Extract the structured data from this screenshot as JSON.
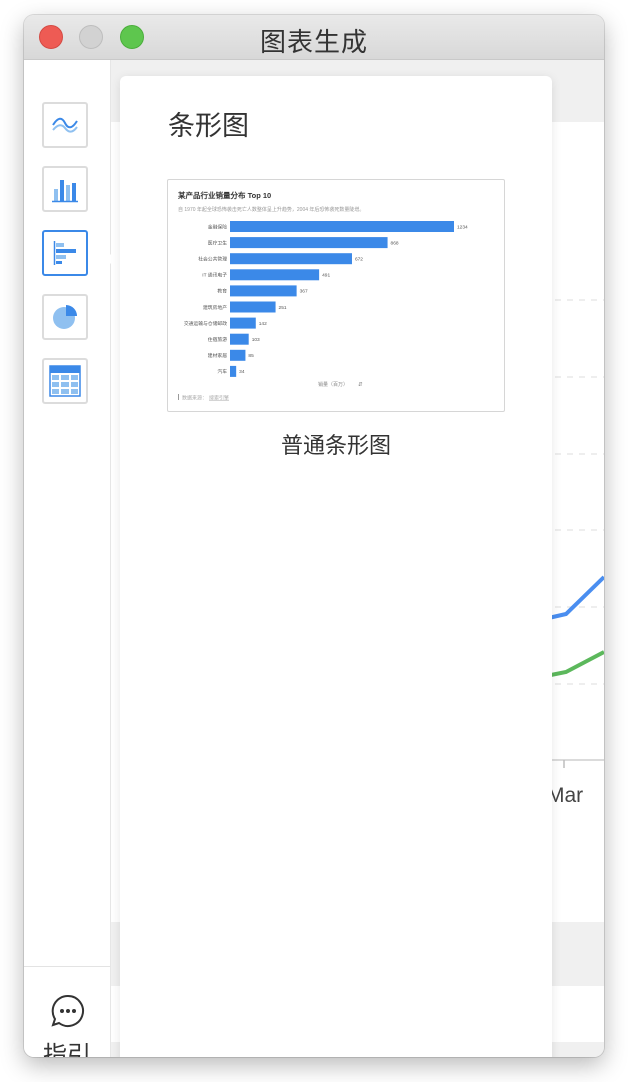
{
  "window": {
    "title": "图表生成"
  },
  "sidebar": {
    "items": [
      {
        "name": "line-chart",
        "icon": "line-chart-icon",
        "active": false
      },
      {
        "name": "column-chart",
        "icon": "column-chart-icon",
        "active": false
      },
      {
        "name": "bar-chart",
        "icon": "bar-chart-icon",
        "active": true
      },
      {
        "name": "pie-chart",
        "icon": "pie-chart-icon",
        "active": false
      },
      {
        "name": "table",
        "icon": "table-icon",
        "active": false
      }
    ],
    "guide_label": "指引"
  },
  "background": {
    "x_tick_label": "Mar",
    "line_colors": [
      "#4a8ef0",
      "#5cb85c"
    ]
  },
  "popover": {
    "title": "条形图",
    "caption": "普通条形图"
  },
  "preview": {
    "title": "某产品行业销量分布 Top 10",
    "subtitle": "自 1970 年起全球恐怖袭击死亡人数整体呈上升趋势，2004 年后恐怖袭死数量陡增。",
    "xlabel": "销量（百万）",
    "source_label": "数据来源：",
    "source_link": "搜索引擎",
    "bar_color": "#3b89e8"
  },
  "chart_data": {
    "type": "bar",
    "categories": [
      "金融保险",
      "医疗卫生",
      "社会公共管理",
      "IT 通讯电子",
      "教育",
      "建筑房地产",
      "交通运输与仓储邮政",
      "住宿旅游",
      "建材家居",
      "汽车"
    ],
    "values": [
      1234,
      868,
      672,
      491,
      367,
      251,
      142,
      103,
      85,
      34
    ],
    "title": "某产品行业销量分布 Top 10",
    "xlabel": "销量（百万）",
    "ylabel": "",
    "xlim": [
      0,
      1234
    ]
  },
  "colors": {
    "accent": "#3b89e8",
    "light_accent": "#8fc0f0"
  }
}
